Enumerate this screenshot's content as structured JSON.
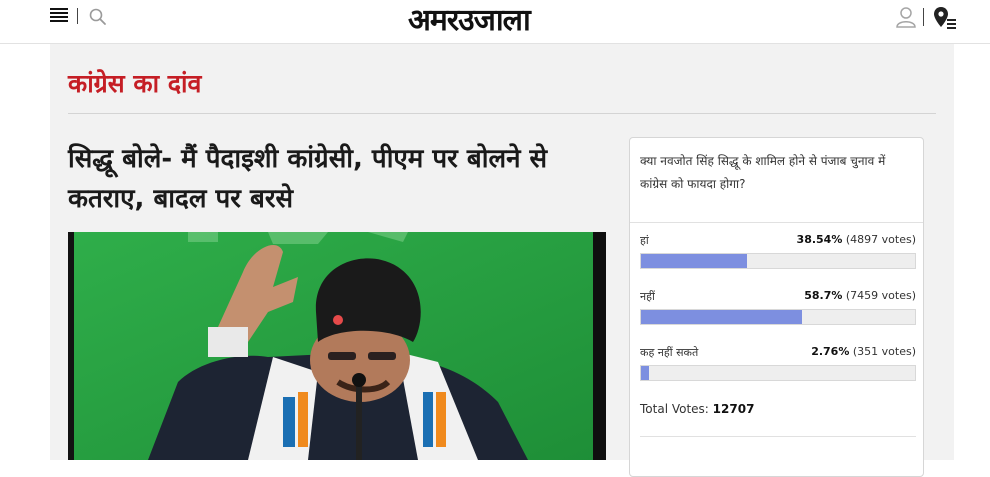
{
  "header": {
    "logo_text": "अमरउजाला",
    "icons": [
      "menu-icon",
      "search-icon",
      "user-icon",
      "location-icon"
    ]
  },
  "section": {
    "title": "कांग्रेस का दांव"
  },
  "article": {
    "headline": "सिद्धू बोले- मैं पैदाइशी कांग्रेसी, पीएम पर बोलने से कतराए, बादल पर बरसे"
  },
  "poll": {
    "question": "क्या नवजोत सिंह सिद्धू के शामिल होने से पंजाब चुनाव में कांग्रेस को फायदा होगा?",
    "options": [
      {
        "label": "हां",
        "percent": "38.54%",
        "votes": "(4897 votes)",
        "fraction": 0.3854
      },
      {
        "label": "नहीं",
        "percent": "58.7%",
        "votes": "(7459 votes)",
        "fraction": 0.587
      },
      {
        "label": "कह नहीं सकते",
        "percent": "2.76%",
        "votes": "(351 votes)",
        "fraction": 0.0276
      }
    ],
    "total_label": "Total Votes:",
    "total_value": "12707"
  },
  "colors": {
    "accent": "#c51e25",
    "bar": "#7d8fe0",
    "background": "#f2f2f2"
  }
}
